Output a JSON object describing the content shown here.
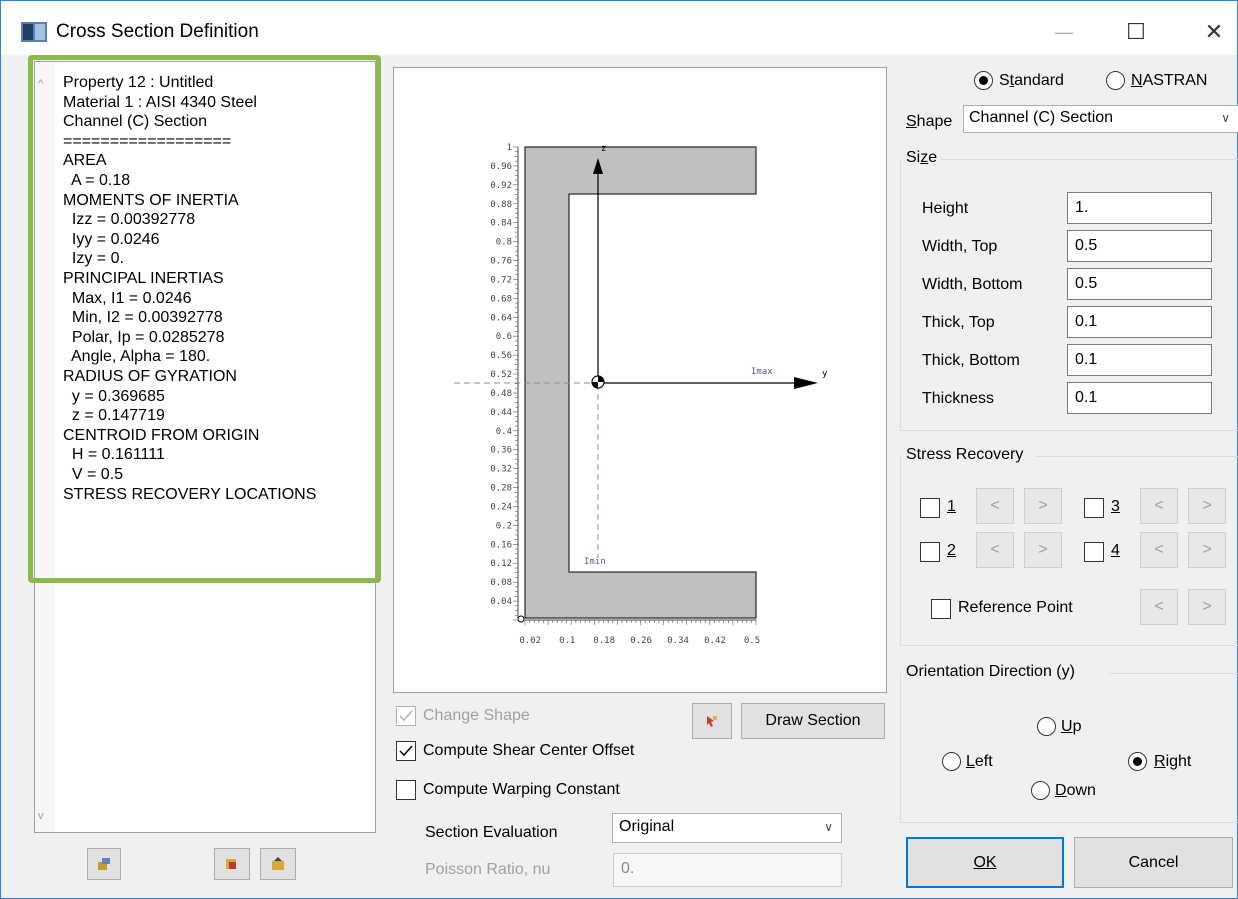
{
  "window": {
    "title": "Cross Section Definition",
    "minimize_glyph": "—",
    "maximize_glyph": "☐",
    "close_glyph": "✕"
  },
  "info_panel": {
    "lines": [
      "Property 12 : Untitled",
      "Material 1 : AISI 4340 Steel",
      "Channel (C) Section",
      "==================",
      "AREA",
      "  A = 0.18",
      "MOMENTS OF INERTIA",
      "  Izz = 0.00392778",
      "  Iyy = 0.0246",
      "  Izy = 0.",
      "PRINCIPAL INERTIAS",
      "  Max, I1 = 0.0246",
      "  Min, I2 = 0.00392778",
      "  Polar, Ip = 0.0285278",
      "  Angle, Alpha = 180.",
      "RADIUS OF GYRATION",
      "  y = 0.369685",
      "  z = 0.147719",
      "CENTROID FROM ORIGIN",
      "  H = 0.161111",
      "  V = 0.5",
      "STRESS RECOVERY LOCATIONS"
    ]
  },
  "plot": {
    "y_ticks": [
      "1",
      "0.96",
      "0.92",
      "0.88",
      "0.84",
      "0.8",
      "0.76",
      "0.72",
      "0.68",
      "0.64",
      "0.6",
      "0.56",
      "0.52",
      "0.48",
      "0.44",
      "0.4",
      "0.36",
      "0.32",
      "0.28",
      "0.24",
      "0.2",
      "0.16",
      "0.12",
      "0.08",
      "0.04"
    ],
    "x_ticks": [
      "0.02",
      "0.1",
      "0.18",
      "0.26",
      "0.34",
      "0.42",
      "0.5"
    ],
    "axis_z": "z",
    "axis_y": "y",
    "label_imax": "Imax",
    "label_imin": "Imin"
  },
  "middle": {
    "change_shape": "Change Shape",
    "compute_shear": "Compute Shear Center Offset",
    "compute_warping": "Compute Warping Constant",
    "draw_section": "Draw Section",
    "section_eval_label": "Section Evaluation",
    "section_eval_value": "Original",
    "poisson_label": "Poisson Ratio, nu",
    "poisson_value": "0."
  },
  "right": {
    "standard": "Standard",
    "nastran": "NASTRAN",
    "shape_label": "Shape",
    "shape_value": "Channel (C) Section",
    "size_label": "Size",
    "sizes": [
      {
        "label": "Height",
        "value": "1."
      },
      {
        "label": "Width, Top",
        "value": "0.5"
      },
      {
        "label": "Width, Bottom",
        "value": "0.5"
      },
      {
        "label": "Thick, Top",
        "value": "0.1"
      },
      {
        "label": "Thick, Bottom",
        "value": "0.1"
      },
      {
        "label": "Thickness",
        "value": "0.1"
      }
    ],
    "stress_recovery": "Stress Recovery",
    "sr": [
      "1",
      "2",
      "3",
      "4"
    ],
    "reference_point": "Reference Point",
    "orientation": "Orientation Direction (y)",
    "up": "Up",
    "left": "Left",
    "right": "Right",
    "down": "Down",
    "ok": "OK",
    "cancel": "Cancel",
    "prev": "<",
    "next": ">"
  }
}
